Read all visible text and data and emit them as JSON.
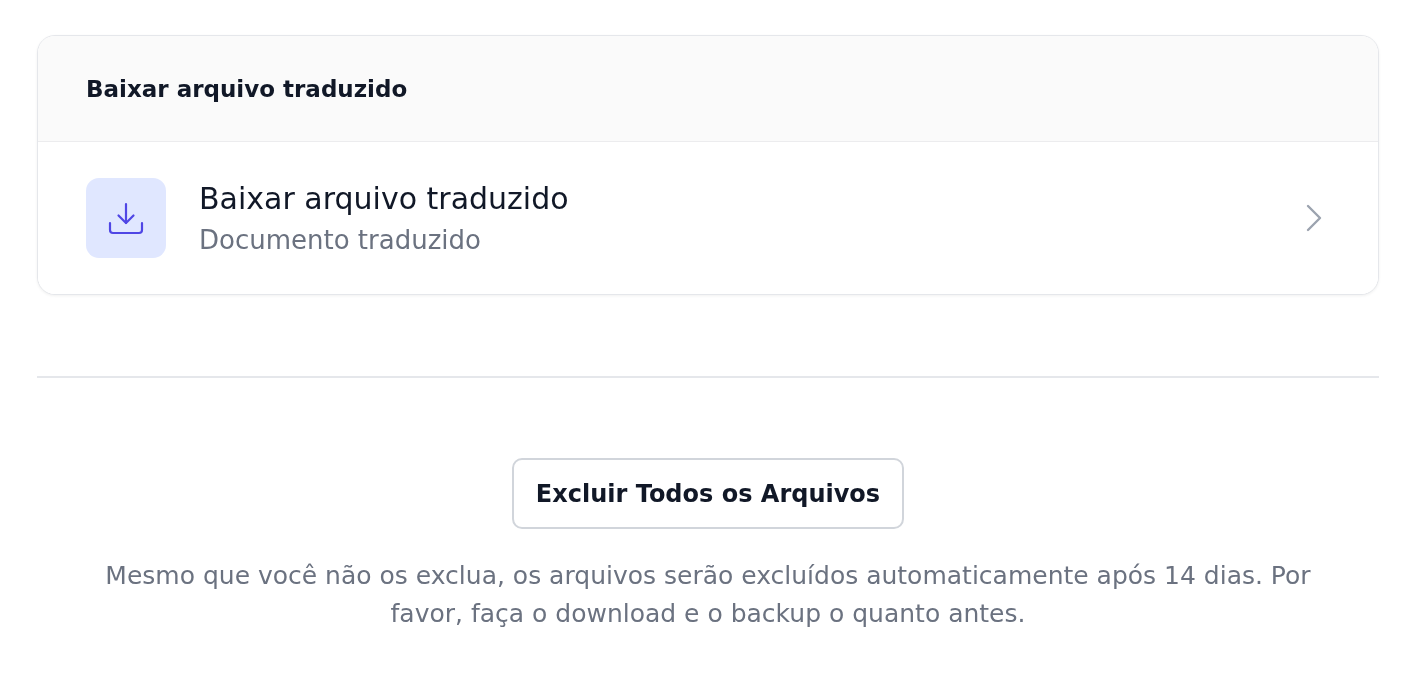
{
  "section": {
    "title": "Baixar arquivo traduzido",
    "items": [
      {
        "title": "Baixar arquivo traduzido",
        "subtitle": "Documento traduzido"
      }
    ]
  },
  "delete_button": {
    "label": "Excluir Todos os Arquivos"
  },
  "notice": "Mesmo que você não os exclua, os arquivos serão excluídos automaticamente após 14 dias. Por favor, faça o download e o backup o quanto antes."
}
